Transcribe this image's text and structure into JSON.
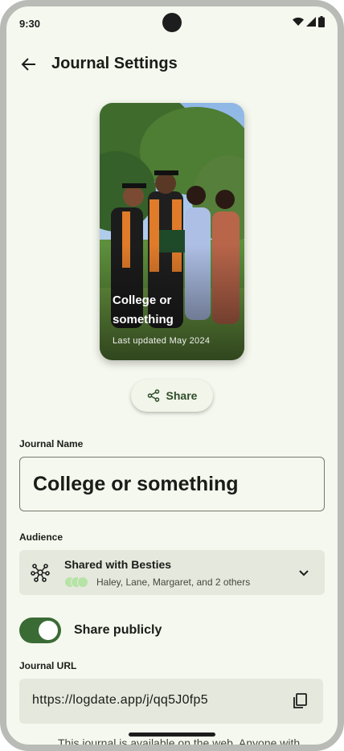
{
  "status_bar": {
    "time": "9:30",
    "icons": [
      "wifi-icon",
      "signal-icon",
      "battery-icon"
    ]
  },
  "header": {
    "title": "Journal Settings",
    "back_icon": "arrow-left-icon"
  },
  "cover": {
    "title": "College or something",
    "subtitle": "Last updated May 2024"
  },
  "share": {
    "label": "Share",
    "icon": "share-icon"
  },
  "journal_name": {
    "label": "Journal Name",
    "value": "College or something"
  },
  "audience": {
    "label": "Audience",
    "title": "Shared with Besties",
    "members": "Haley, Lane, Margaret, and 2 others",
    "icon": "network-icon",
    "chevron": "chevron-down-icon"
  },
  "share_publicly": {
    "label": "Share publicly",
    "enabled": true
  },
  "journal_url": {
    "label": "Journal URL",
    "value": "https://logdate.app/j/qq5J0fp5",
    "copy_icon": "copy-icon"
  },
  "footnote": "This journal is available on the web. Anyone with",
  "colors": {
    "background": "#f5f8ee",
    "accent": "#3a6b35",
    "surface": "#e5e8dc"
  }
}
